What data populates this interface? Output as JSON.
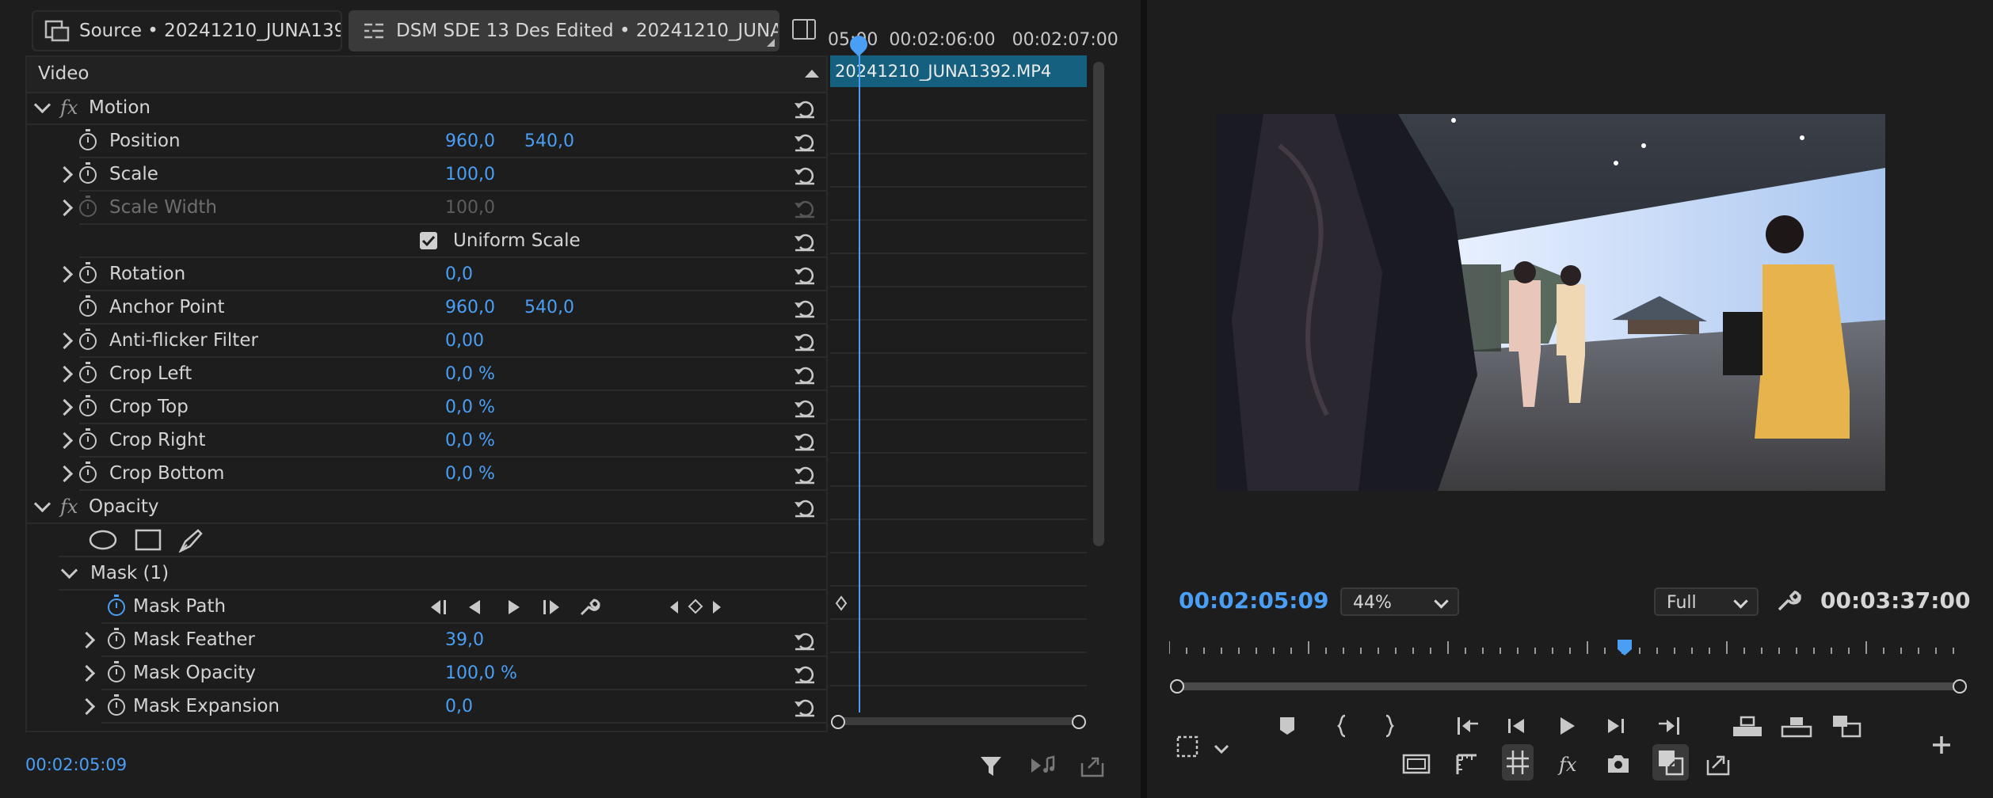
{
  "tabs": {
    "source": "Source • 20241210_JUNA1392...",
    "sequence": "DSM SDE 13 Des Edited • 20241210_JUNA13..."
  },
  "effect_controls": {
    "section": "Video",
    "motion": {
      "title": "Motion",
      "params": [
        {
          "name": "Position",
          "v1": "960,0",
          "v2": "540,0"
        },
        {
          "name": "Scale",
          "v1": "100,0"
        },
        {
          "name": "Scale Width",
          "v1": "100,0"
        },
        {
          "name": "Uniform Scale",
          "checked": true
        },
        {
          "name": "Rotation",
          "v1": "0,0"
        },
        {
          "name": "Anchor Point",
          "v1": "960,0",
          "v2": "540,0"
        },
        {
          "name": "Anti-flicker Filter",
          "v1": "0,00"
        },
        {
          "name": "Crop Left",
          "v1": "0,0 %"
        },
        {
          "name": "Crop Top",
          "v1": "0,0 %"
        },
        {
          "name": "Crop Right",
          "v1": "0,0 %"
        },
        {
          "name": "Crop Bottom",
          "v1": "0,0 %"
        }
      ]
    },
    "opacity": {
      "title": "Opacity",
      "mask": "Mask (1)",
      "mask_params": [
        {
          "name": "Mask Path"
        },
        {
          "name": "Mask Feather",
          "v1": "39,0"
        },
        {
          "name": "Mask Opacity",
          "v1": "100,0 %"
        },
        {
          "name": "Mask Expansion",
          "v1": "0,0"
        }
      ]
    }
  },
  "timeline": {
    "ruler": "05:00  00:02:06:00   00:02:07:00",
    "clip_name": "20241210_JUNA1392.MP4"
  },
  "bottom_timecode": "00:02:05:09",
  "program": {
    "current_timecode": "00:02:05:09",
    "zoom": "44%",
    "quality": "Full",
    "duration": "00:03:37:00"
  },
  "colors": {
    "accent": "#4a9ff5",
    "clip": "#16607f"
  }
}
